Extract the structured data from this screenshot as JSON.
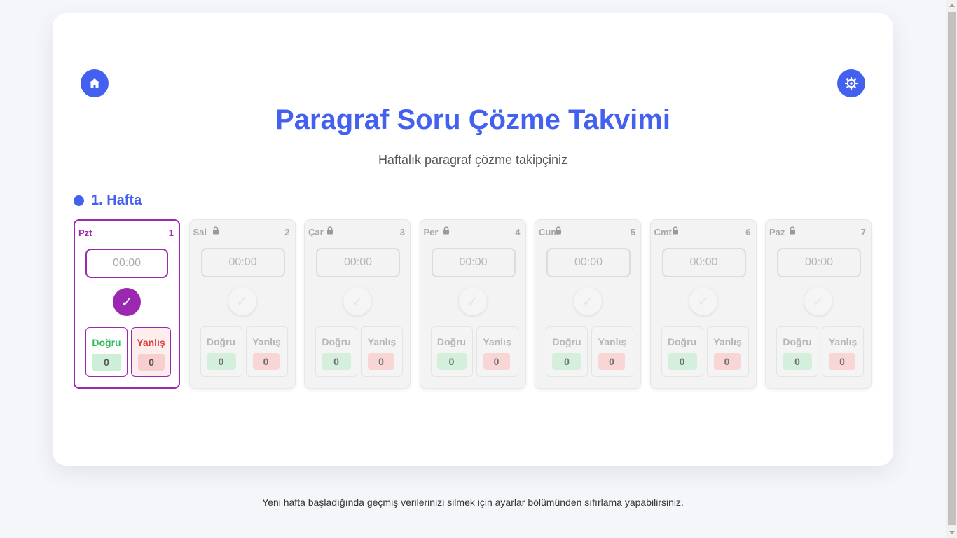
{
  "header": {
    "title": "Paragraf Soru Çözme Takvimi",
    "subtitle": "Haftalık paragraf çözme takipçiniz",
    "home_icon": "home-icon",
    "settings_icon": "gear-icon"
  },
  "week": {
    "title": "1. Hafta"
  },
  "days": [
    {
      "name": "Pzt",
      "num": "1",
      "time_placeholder": "00:00",
      "check": "✓",
      "correct_label": "Doğru",
      "correct_val": "0",
      "wrong_label": "Yanlış",
      "wrong_val": "0",
      "locked": false
    },
    {
      "name": "Sal",
      "num": "2",
      "time_placeholder": "00:00",
      "check": "✓",
      "correct_label": "Doğru",
      "correct_val": "0",
      "wrong_label": "Yanlış",
      "wrong_val": "0",
      "locked": true
    },
    {
      "name": "Çar",
      "num": "3",
      "time_placeholder": "00:00",
      "check": "✓",
      "correct_label": "Doğru",
      "correct_val": "0",
      "wrong_label": "Yanlış",
      "wrong_val": "0",
      "locked": true
    },
    {
      "name": "Per",
      "num": "4",
      "time_placeholder": "00:00",
      "check": "✓",
      "correct_label": "Doğru",
      "correct_val": "0",
      "wrong_label": "Yanlış",
      "wrong_val": "0",
      "locked": true
    },
    {
      "name": "Cum",
      "num": "5",
      "time_placeholder": "00:00",
      "check": "✓",
      "correct_label": "Doğru",
      "correct_val": "0",
      "wrong_label": "Yanlış",
      "wrong_val": "0",
      "locked": true
    },
    {
      "name": "Cmt",
      "num": "6",
      "time_placeholder": "00:00",
      "check": "✓",
      "correct_label": "Doğru",
      "correct_val": "0",
      "wrong_label": "Yanlış",
      "wrong_val": "0",
      "locked": true
    },
    {
      "name": "Paz",
      "num": "7",
      "time_placeholder": "00:00",
      "check": "✓",
      "correct_label": "Doğru",
      "correct_val": "0",
      "wrong_label": "Yanlış",
      "wrong_val": "0",
      "locked": true
    }
  ],
  "footer": {
    "text": "Yeni hafta başladığında geçmiş verilerinizi silmek için ayarlar bölümünden sıfırlama yapabilirsiniz."
  },
  "colors": {
    "accent": "#4361ee",
    "active_day": "#9c27b0",
    "correct": "#2ebd5b",
    "wrong": "#e03a3a"
  }
}
